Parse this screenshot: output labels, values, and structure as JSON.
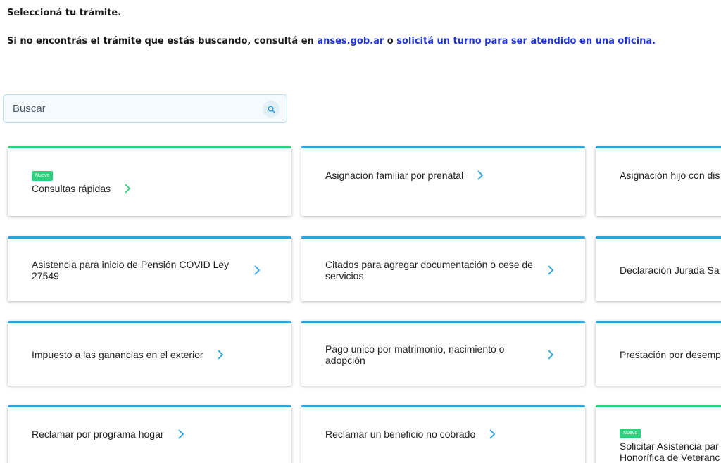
{
  "header": {
    "title": "Seleccioná tu trámite.",
    "info_prefix": "Si no encontrás el trámite que estás buscando, consultá en ",
    "info_link_site": "anses.gob.ar",
    "info_connector": " o ",
    "info_link_turno": "solicitá un turno para ser atendido en una oficina."
  },
  "search": {
    "placeholder": "Buscar",
    "icon": "search-icon"
  },
  "colors": {
    "accent_blue": "#2aa3de",
    "accent_green": "#2ecf7c",
    "link": "#1f33d6"
  },
  "cards": [
    {
      "label": "Consultas rápidas",
      "badge": "Nuevo",
      "accent": "green"
    },
    {
      "label": "Asignación familiar por prenatal",
      "badge": "",
      "accent": "blue"
    },
    {
      "label": "Asignación hijo con dis",
      "badge": "",
      "accent": "blue"
    },
    {
      "label": "Asistencia para inicio de Pensión COVID Ley 27549",
      "badge": "",
      "accent": "blue"
    },
    {
      "label": "Citados para agregar documentación o cese de servicios",
      "badge": "",
      "accent": "blue"
    },
    {
      "label": "Declaración Jurada Sa",
      "badge": "",
      "accent": "blue"
    },
    {
      "label": "Impuesto a las ganancias en el exterior",
      "badge": "",
      "accent": "blue"
    },
    {
      "label": "Pago unico por matrimonio, nacimiento o adopción",
      "badge": "",
      "accent": "blue"
    },
    {
      "label": "Prestación por desemp",
      "badge": "",
      "accent": "blue"
    },
    {
      "label": "Reclamar por programa hogar",
      "badge": "",
      "accent": "blue"
    },
    {
      "label": "Reclamar un beneficio no cobrado",
      "badge": "",
      "accent": "blue"
    },
    {
      "label": "Solicitar Asistencia par Honorífica de Veteranc",
      "badge": "Nuevo",
      "accent": "green"
    }
  ]
}
